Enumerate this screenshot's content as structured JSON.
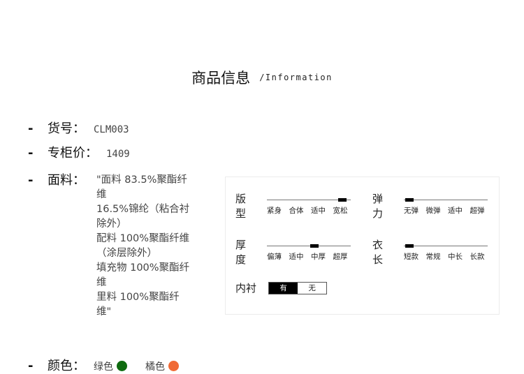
{
  "header": {
    "title_zh": "商品信息",
    "title_en": "/Information"
  },
  "product": {
    "sku_label": "货号：",
    "sku": "CLM003",
    "price_label": "专柜价：",
    "price": "1409",
    "fabric_label": "面料：",
    "fabric_lines": [
      "\"面料 83.5%聚酯纤",
      "维",
      "16.5%锦纶（粘合衬",
      "除外）",
      "配料 100%聚酯纤维",
      "（涂层除外）",
      "填充物 100%聚酯纤",
      "维",
      "里料 100%聚酯纤",
      "维\""
    ],
    "color_label": "颜色：",
    "colors": [
      {
        "name": "绿色",
        "hex": "#0f6b10"
      },
      {
        "name": "橘色",
        "hex": "#f06a35"
      }
    ]
  },
  "attributes": {
    "fit": {
      "label": "版型",
      "options": [
        "紧身",
        "合体",
        "适中",
        "宽松"
      ],
      "selected_index": 3
    },
    "elasticity": {
      "label": "弹力",
      "options": [
        "无弹",
        "微弹",
        "适中",
        "超弹"
      ],
      "selected_index": 0
    },
    "thickness": {
      "label": "厚度",
      "options": [
        "偏薄",
        "适中",
        "中厚",
        "超厚"
      ],
      "selected_index": 2
    },
    "length": {
      "label": "衣长",
      "options": [
        "短款",
        "常规",
        "中长",
        "长款"
      ],
      "selected_index": 0
    },
    "lining": {
      "label": "内衬",
      "options": [
        "有",
        "无"
      ],
      "selected": "有"
    }
  },
  "bullet": "-"
}
